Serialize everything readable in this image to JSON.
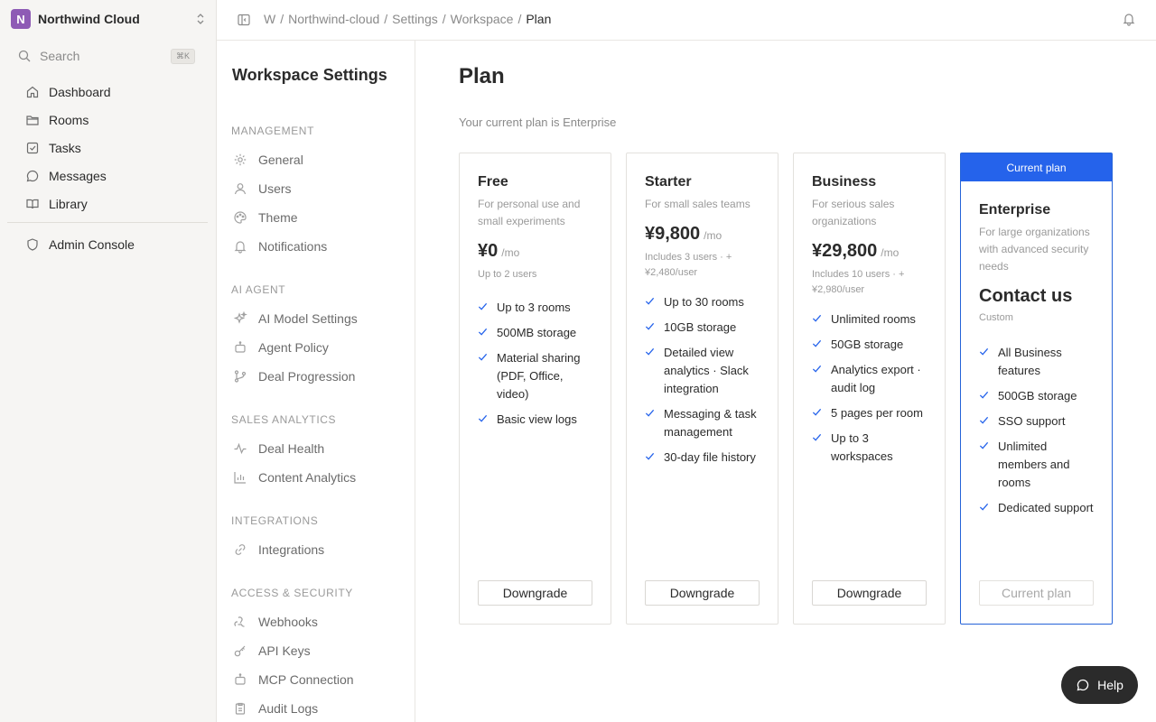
{
  "workspace": {
    "initial": "N",
    "name": "Northwind Cloud"
  },
  "search": {
    "label": "Search",
    "shortcut": "⌘K"
  },
  "nav": {
    "items": [
      {
        "label": "Dashboard",
        "icon": "home-icon"
      },
      {
        "label": "Rooms",
        "icon": "folder-icon"
      },
      {
        "label": "Tasks",
        "icon": "checkbox-icon"
      },
      {
        "label": "Messages",
        "icon": "chat-icon"
      },
      {
        "label": "Library",
        "icon": "book-icon"
      }
    ],
    "admin": {
      "label": "Admin Console",
      "icon": "shield-icon"
    }
  },
  "breadcrumb": {
    "items": [
      "W",
      "Northwind-cloud",
      "Settings",
      "Workspace"
    ],
    "current": "Plan"
  },
  "settings": {
    "title": "Workspace Settings",
    "sections": [
      {
        "title": "MANAGEMENT",
        "items": [
          "General",
          "Users",
          "Theme",
          "Notifications"
        ]
      },
      {
        "title": "AI AGENT",
        "items": [
          "AI Model Settings",
          "Agent Policy",
          "Deal Progression"
        ]
      },
      {
        "title": "SALES ANALYTICS",
        "items": [
          "Deal Health",
          "Content Analytics"
        ]
      },
      {
        "title": "INTEGRATIONS",
        "items": [
          "Integrations"
        ]
      },
      {
        "title": "ACCESS & SECURITY",
        "items": [
          "Webhooks",
          "API Keys",
          "MCP Connection",
          "Audit Logs"
        ]
      }
    ]
  },
  "main": {
    "title": "Plan",
    "subtitle": "Your current plan is Enterprise",
    "current_label": "Current plan",
    "plans": [
      {
        "name": "Free",
        "description": "For personal use and small experiments",
        "price": "¥0",
        "per": "/mo",
        "note": "Up to 2 users",
        "features": [
          "Up to 3 rooms",
          "500MB storage",
          "Material sharing (PDF, Office, video)",
          "Basic view logs"
        ],
        "button": "Downgrade"
      },
      {
        "name": "Starter",
        "description": "For small sales teams",
        "price": "¥9,800",
        "per": "/mo",
        "note": "Includes 3 users · + ¥2,480/user",
        "features": [
          "Up to 30 rooms",
          "10GB storage",
          "Detailed view analytics · Slack integration",
          "Messaging & task management",
          "30-day file history"
        ],
        "button": "Downgrade"
      },
      {
        "name": "Business",
        "description": "For serious sales organizations",
        "price": "¥29,800",
        "per": "/mo",
        "note": "Includes 10 users · + ¥2,980/user",
        "features": [
          "Unlimited rooms",
          "50GB storage",
          "Analytics export · audit log",
          "5 pages per room",
          "Up to 3 workspaces"
        ],
        "button": "Downgrade"
      },
      {
        "name": "Enterprise",
        "description": "For large organizations with advanced security needs",
        "price": "Contact us",
        "per": "",
        "note": "Custom",
        "features": [
          "All Business features",
          "500GB storage",
          "SSO support",
          "Unlimited members and rooms",
          "Dedicated support"
        ],
        "button": "Current plan"
      }
    ]
  },
  "help": {
    "label": "Help"
  },
  "colors": {
    "accent": "#2563eb",
    "workspace_logo": "#8e5bb5",
    "help_bg": "#2b2b2b"
  }
}
